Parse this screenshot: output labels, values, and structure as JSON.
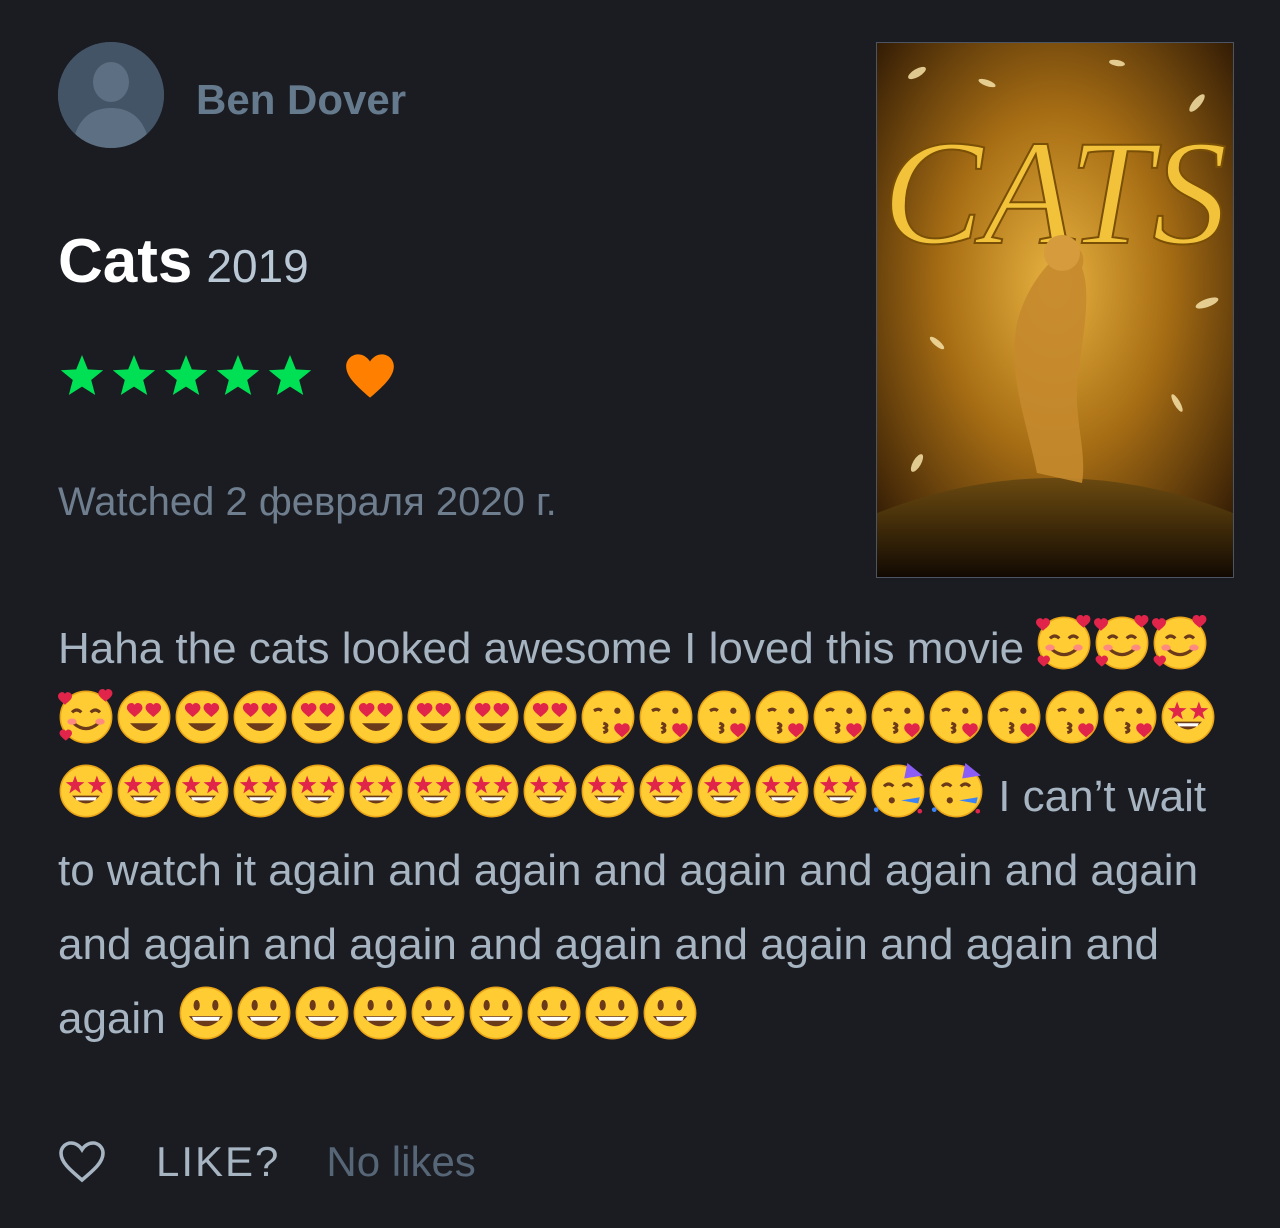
{
  "user": {
    "name": "Ben Dover",
    "avatar_icon": "default-avatar-icon"
  },
  "film": {
    "title": "Cats",
    "year": "2019",
    "poster_text": "CATS"
  },
  "rating": {
    "stars": 5,
    "max_stars": 5,
    "star_color": "#00e054",
    "liked": true,
    "liked_color": "#ff8000"
  },
  "watched": "Watched 2 февраля 2020 г.",
  "review": {
    "segments": [
      {
        "type": "text",
        "value": "Haha the cats looked awesome I loved this movie "
      },
      {
        "type": "emoji",
        "name": "smiling-face-with-hearts",
        "count": 4
      },
      {
        "type": "emoji",
        "name": "heart-eyes",
        "count": 8
      },
      {
        "type": "emoji",
        "name": "face-blowing-kiss",
        "count": 10
      },
      {
        "type": "emoji",
        "name": "star-struck",
        "count": 15
      },
      {
        "type": "emoji",
        "name": "partying-face",
        "count": 2
      },
      {
        "type": "text",
        "value": " I can’t wait to watch it again and again and again and again and again and again and again and again and again and again and again "
      },
      {
        "type": "emoji",
        "name": "grinning-face",
        "count": 9
      }
    ]
  },
  "footer": {
    "like_label": "LIKE?",
    "likes_text": "No likes"
  },
  "colors": {
    "background": "#1a1c22",
    "muted_text": "#a7b4c1",
    "heading": "#ffffff"
  }
}
